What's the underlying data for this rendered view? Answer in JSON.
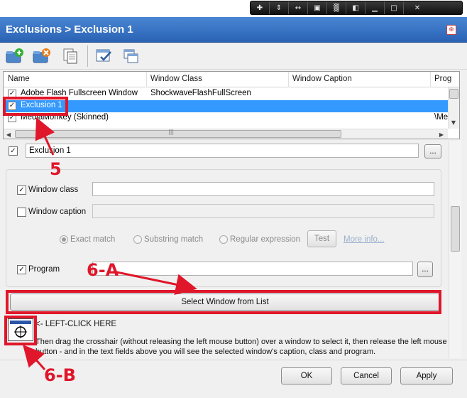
{
  "window": {
    "title": "Exclusions > Exclusion 1"
  },
  "toolbar": {
    "buttons": [
      {
        "name": "add-exclusion",
        "icon": "folder-plus-icon"
      },
      {
        "name": "delete-exclusion",
        "icon": "folder-x-icon"
      },
      {
        "name": "duplicate-exclusion",
        "icon": "copy-pages-icon"
      },
      {
        "name": "check-all",
        "icon": "checklist-icon"
      },
      {
        "name": "uncheck-all",
        "icon": "window-stack-icon"
      }
    ]
  },
  "list": {
    "columns": [
      "Name",
      "Window Class",
      "Window Caption",
      "Prog"
    ],
    "rows": [
      {
        "checked": true,
        "name": "Adobe Flash Fullscreen Window",
        "class": "ShockwaveFlashFullScreen",
        "caption": "",
        "program": ""
      },
      {
        "checked": true,
        "name": "Exclusion 1",
        "class": "",
        "caption": "",
        "program": "",
        "selected": true
      },
      {
        "checked": true,
        "name": "MediaMonkey (Skinned)",
        "class": "",
        "caption": "",
        "program": "\\Me"
      }
    ]
  },
  "details": {
    "name_value": "Exclusion 1",
    "browse_label": "...",
    "window_class": {
      "label": "Window class",
      "checked": true,
      "value": ""
    },
    "window_caption": {
      "label": "Window caption",
      "checked": false,
      "value": ""
    },
    "match": {
      "options": [
        "Exact match",
        "Substring match",
        "Regular expression"
      ],
      "selected": "Exact match",
      "test_label": "Test",
      "more_info": "More info..."
    },
    "program": {
      "label": "Program",
      "checked": true,
      "value": "",
      "browse_label": "..."
    },
    "select_window_label": "Select Window from List",
    "left_click_label": "<- LEFT-CLICK HERE",
    "help_text": "Then drag the crosshair (without releasing the left mouse button) over a window to select it, then release the left mouse button - and in the text fields above you will see the selected window's caption, class and program."
  },
  "footer": {
    "ok_label": "OK",
    "cancel_label": "Cancel",
    "apply_label": "Apply"
  },
  "annotations": {
    "label_5": "5",
    "label_6a": "6-A",
    "label_6b": "6-B",
    "color": "#e0162a"
  },
  "colors": {
    "titlebar": "#3572c6",
    "selection": "#3399ff"
  }
}
